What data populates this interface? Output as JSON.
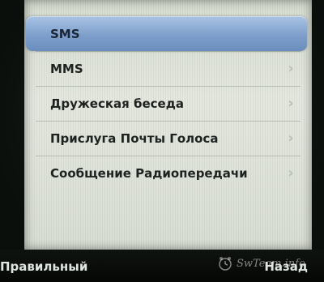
{
  "menu": {
    "items": [
      {
        "label": "SMS",
        "selected": true
      },
      {
        "label": "MMS",
        "selected": false
      },
      {
        "label": "Дружеская беседа",
        "selected": false
      },
      {
        "label": "Прислуга Почты Голоса",
        "selected": false
      },
      {
        "label": "Сообщение Радиопередачи",
        "selected": false
      }
    ]
  },
  "softkeys": {
    "left_label": "Правильный",
    "right_label": "Назад"
  },
  "watermark": {
    "text": "SwTeam.info"
  },
  "colors": {
    "selection": "#7e9fcb",
    "screen_background": "#dfe4da",
    "softkey_bar": "#0a0d0a",
    "softkey_text": "#dfe5e0"
  },
  "icons": {
    "chevron": "chevron-right-icon",
    "watermark_logo": "alarm-clock-logo-icon"
  }
}
